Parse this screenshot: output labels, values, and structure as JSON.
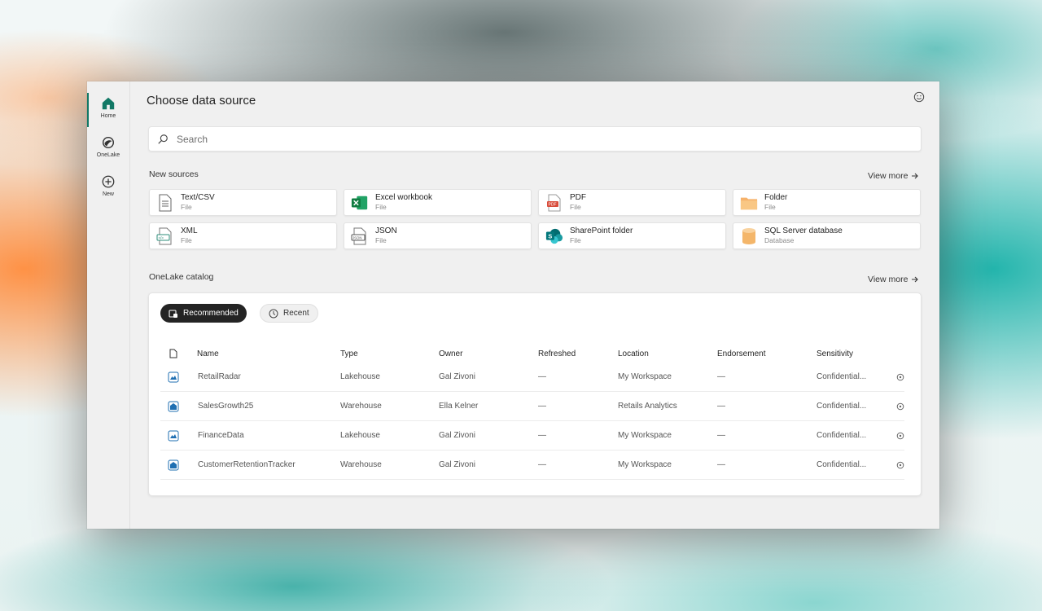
{
  "rail": {
    "items": [
      {
        "label": "Home",
        "icon": "home-icon"
      },
      {
        "label": "OneLake",
        "icon": "onelake-icon"
      },
      {
        "label": "New",
        "icon": "plus-circle-icon"
      }
    ]
  },
  "title": "Choose data source",
  "search": {
    "placeholder": "Search"
  },
  "new_sources": {
    "label": "New sources",
    "view_more": "View more",
    "tiles": [
      {
        "name": "Text/CSV",
        "type": "File",
        "icon": "text-file-icon"
      },
      {
        "name": "Excel workbook",
        "type": "File",
        "icon": "excel-icon"
      },
      {
        "name": "PDF",
        "type": "File",
        "icon": "pdf-icon"
      },
      {
        "name": "Folder",
        "type": "File",
        "icon": "folder-icon"
      },
      {
        "name": "XML",
        "type": "File",
        "icon": "xml-icon"
      },
      {
        "name": "JSON",
        "type": "File",
        "icon": "json-icon"
      },
      {
        "name": "SharePoint folder",
        "type": "File",
        "icon": "sharepoint-icon"
      },
      {
        "name": "SQL Server database",
        "type": "Database",
        "icon": "database-icon"
      }
    ]
  },
  "catalog": {
    "label": "OneLake catalog",
    "view_more": "View more",
    "tabs": [
      {
        "label": "Recommended",
        "active": true
      },
      {
        "label": "Recent",
        "active": false
      }
    ],
    "columns": [
      "Name",
      "Type",
      "Owner",
      "Refreshed",
      "Location",
      "Endorsement",
      "Sensitivity"
    ],
    "rows": [
      {
        "name": "RetailRadar",
        "type": "Lakehouse",
        "owner": "Gal Zivoni",
        "refreshed": "—",
        "location": "My Workspace",
        "endorsement": "—",
        "sensitivity": "Confidential..."
      },
      {
        "name": "SalesGrowth25",
        "type": "Warehouse",
        "owner": "Ella Kelner",
        "refreshed": "—",
        "location": "Retails Analytics",
        "endorsement": "—",
        "sensitivity": "Confidential..."
      },
      {
        "name": "FinanceData",
        "type": "Lakehouse",
        "owner": "Gal Zivoni",
        "refreshed": "—",
        "location": "My Workspace",
        "endorsement": "—",
        "sensitivity": "Confidential..."
      },
      {
        "name": "CustomerRetentionTracker",
        "type": "Warehouse",
        "owner": "Gal Zivoni",
        "refreshed": "—",
        "location": "My Workspace",
        "endorsement": "—",
        "sensitivity": "Confidential..."
      }
    ]
  },
  "colors": {
    "accent": "#117865",
    "excel": "#1d6f42",
    "sharepoint": "#038387",
    "folder": "#f6b26b",
    "database": "#f4b66a"
  }
}
